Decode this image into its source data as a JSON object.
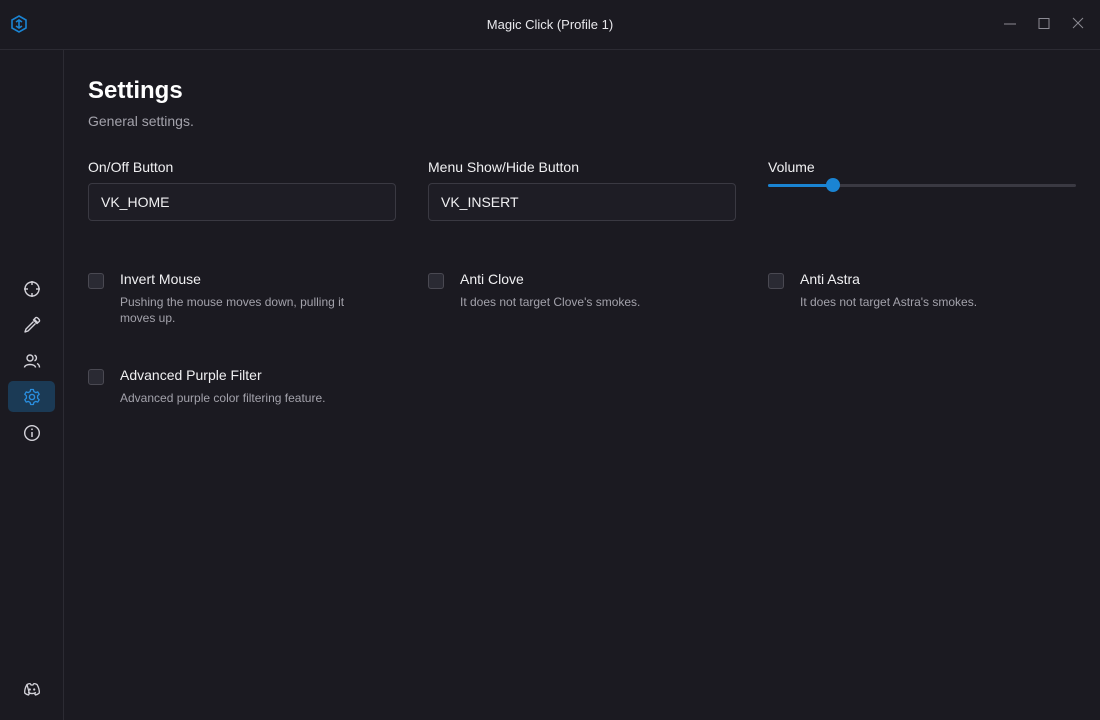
{
  "window": {
    "title": "Magic Click (Profile 1)"
  },
  "sidebar": {
    "items": [
      {
        "icon": "crosshair-icon",
        "active": false
      },
      {
        "icon": "eyedropper-icon",
        "active": false
      },
      {
        "icon": "users-icon",
        "active": false
      },
      {
        "icon": "gear-icon",
        "active": true
      },
      {
        "icon": "info-icon",
        "active": false
      }
    ],
    "footer_icon": "discord-icon"
  },
  "page": {
    "title": "Settings",
    "subtitle": "General settings."
  },
  "fields": {
    "onoff": {
      "label": "On/Off Button",
      "value": "VK_HOME"
    },
    "menu": {
      "label": "Menu Show/Hide Button",
      "value": "VK_INSERT"
    },
    "volume": {
      "label": "Volume",
      "level": 0.21
    }
  },
  "options": [
    {
      "title": "Invert Mouse",
      "desc": "Pushing the mouse moves down, pulling it moves up.",
      "checked": false
    },
    {
      "title": "Anti Clove",
      "desc": "It does not target Clove's smokes.",
      "checked": false
    },
    {
      "title": "Anti Astra",
      "desc": "It does not target Astra's smokes.",
      "checked": false
    },
    {
      "title": "Advanced Purple Filter",
      "desc": "Advanced purple color filtering feature.",
      "checked": false
    }
  ],
  "colors": {
    "accent": "#1a84d3",
    "background": "#1b1a21",
    "active_nav": "#1b3a55"
  }
}
